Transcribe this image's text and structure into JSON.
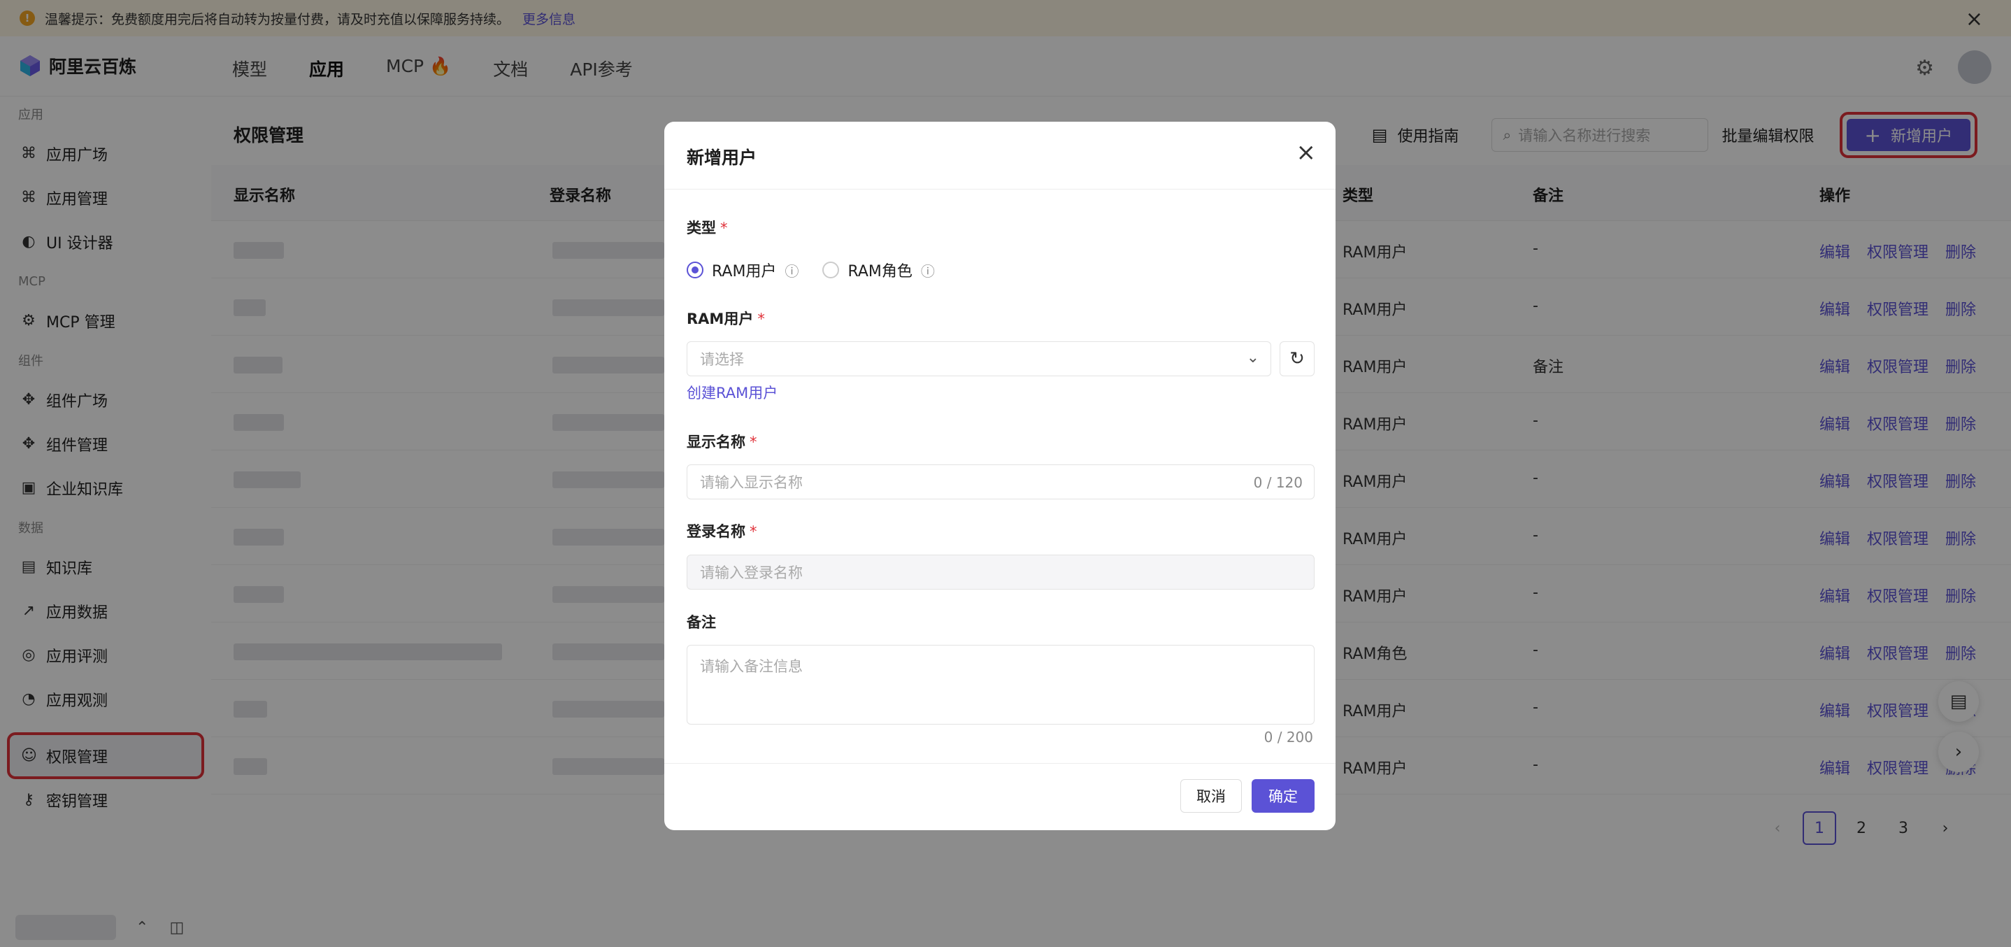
{
  "notice": {
    "text": "温馨提示：免费额度用完后将自动转为按量付费，请及时充值以保障服务持续。",
    "link": "更多信息",
    "icon": "warning-icon"
  },
  "brand": {
    "name": "阿里云百炼"
  },
  "topnav": [
    {
      "label": "模型"
    },
    {
      "label": "应用"
    },
    {
      "label": "MCP 🔥"
    },
    {
      "label": "文档"
    },
    {
      "label": "API参考"
    }
  ],
  "sidebar": {
    "group_app": "应用",
    "app_items": [
      {
        "label": "应用广场",
        "icon": "⌘"
      },
      {
        "label": "应用管理",
        "icon": "⌘"
      },
      {
        "label": "UI 设计器",
        "icon": "◐"
      }
    ],
    "group_mcp": "MCP",
    "mcp_items": [
      {
        "label": "MCP 管理",
        "icon": "⚙"
      }
    ],
    "group_comp": "组件",
    "comp_items": [
      {
        "label": "组件广场",
        "icon": "✥"
      },
      {
        "label": "组件管理",
        "icon": "✥"
      },
      {
        "label": "企业知识库",
        "icon": "▣"
      }
    ],
    "group_data": "数据",
    "data_items": [
      {
        "label": "知识库",
        "icon": "▤"
      },
      {
        "label": "应用数据",
        "icon": "↗"
      },
      {
        "label": "应用评测",
        "icon": "◎"
      },
      {
        "label": "应用观测",
        "icon": "◔"
      }
    ],
    "active_item": {
      "label": "权限管理",
      "icon": "☺"
    },
    "key_item": {
      "label": "密钥管理",
      "icon": "⚷"
    }
  },
  "main": {
    "title": "权限管理",
    "guide": "使用指南",
    "search_placeholder": "请输入名称进行搜索",
    "batch": "批量编辑权限",
    "add": "新增用户",
    "columns": {
      "display": "显示名称",
      "login": "登录名称",
      "type": "类型",
      "note": "备注",
      "ops": "操作"
    },
    "rows": [
      {
        "type": "RAM用户",
        "note": "-"
      },
      {
        "type": "RAM用户",
        "note": "-"
      },
      {
        "type": "RAM用户",
        "note": "备注"
      },
      {
        "type": "RAM用户",
        "note": "-"
      },
      {
        "type": "RAM用户",
        "note": "-"
      },
      {
        "type": "RAM用户",
        "note": "-"
      },
      {
        "type": "RAM用户",
        "note": "-"
      },
      {
        "type": "RAM角色",
        "note": "-"
      },
      {
        "type": "RAM用户",
        "note": "-"
      },
      {
        "type": "RAM用户",
        "note": "-"
      }
    ],
    "op_edit": "编辑",
    "op_perm": "权限管理",
    "op_delete": "删除",
    "pages": [
      "1",
      "2",
      "3"
    ]
  },
  "modal": {
    "title": "新增用户",
    "type_label": "类型",
    "opt_user": "RAM用户",
    "opt_role": "RAM角色",
    "ram_label": "RAM用户",
    "select_placeholder": "请选择",
    "create_link": "创建RAM用户",
    "display_label": "显示名称",
    "display_placeholder": "请输入显示名称",
    "display_count": "0 / 120",
    "login_label": "登录名称",
    "login_placeholder": "请输入登录名称",
    "note_label": "备注",
    "note_placeholder": "请输入备注信息",
    "note_count": "0 / 200",
    "cancel": "取消",
    "ok": "确定",
    "required_mark": "*"
  },
  "colors": {
    "accent": "#5b52d6",
    "highlight": "#e0323a"
  }
}
